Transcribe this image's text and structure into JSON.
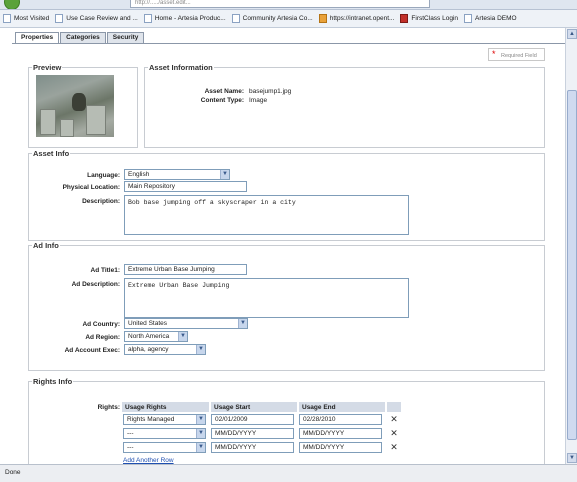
{
  "browser": {
    "address": "http://...../asset.edit...",
    "bookmarks": [
      {
        "label": "Most Visited",
        "icon": "star-icon"
      },
      {
        "label": "Use Case Review and ...",
        "icon": "page-icon"
      },
      {
        "label": "Home - Artesia Produc...",
        "icon": "page-icon"
      },
      {
        "label": "Community Artesia Co...",
        "icon": "page-icon"
      },
      {
        "label": "https://intranet.opent...",
        "icon": "arrows-icon"
      },
      {
        "label": "FirstClass Login",
        "icon": "firstclass-icon"
      },
      {
        "label": "Artesia DEMO",
        "icon": "page-icon"
      }
    ],
    "status": "Done"
  },
  "tabs": [
    {
      "label": "Properties",
      "active": true
    },
    {
      "label": "Categories",
      "active": false
    },
    {
      "label": "Security",
      "active": false
    }
  ],
  "required_note": "Required Field",
  "preview": {
    "legend": "Preview"
  },
  "asset_information": {
    "legend": "Asset Information",
    "name_label": "Asset Name:",
    "name_value": "basejump1.jpg",
    "type_label": "Content Type:",
    "type_value": "Image"
  },
  "asset_info": {
    "legend": "Asset Info",
    "language_label": "Language:",
    "language_value": "English",
    "location_label": "Physical Location:",
    "location_value": "Main Repository",
    "description_label": "Description:",
    "description_value": "Bob base jumping off a skyscraper in a city"
  },
  "ad_info": {
    "legend": "Ad Info",
    "title_label": "Ad Title1:",
    "title_value": "Extreme Urban Base Jumping",
    "description_label": "Ad Description:",
    "description_value": "Extreme Urban Base Jumping",
    "country_label": "Ad Country:",
    "country_value": "United States",
    "region_label": "Ad Region:",
    "region_value": "North America",
    "exec_label": "Ad Account Exec:",
    "exec_value": "alpha, agency"
  },
  "rights_info": {
    "legend": "Rights Info",
    "rights_label": "Rights:",
    "columns": [
      "Usage Rights",
      "Usage Start",
      "Usage End"
    ],
    "rows": [
      {
        "rights": "Rights Managed",
        "start": "02/01/2009",
        "end": "02/28/2010"
      },
      {
        "rights": "---",
        "start": "MM/DD/YYYY",
        "end": "MM/DD/YYYY"
      },
      {
        "rights": "---",
        "start": "MM/DD/YYYY",
        "end": "MM/DD/YYYY"
      }
    ],
    "remove_glyph": "✕",
    "add_row": "Add Another Row"
  }
}
